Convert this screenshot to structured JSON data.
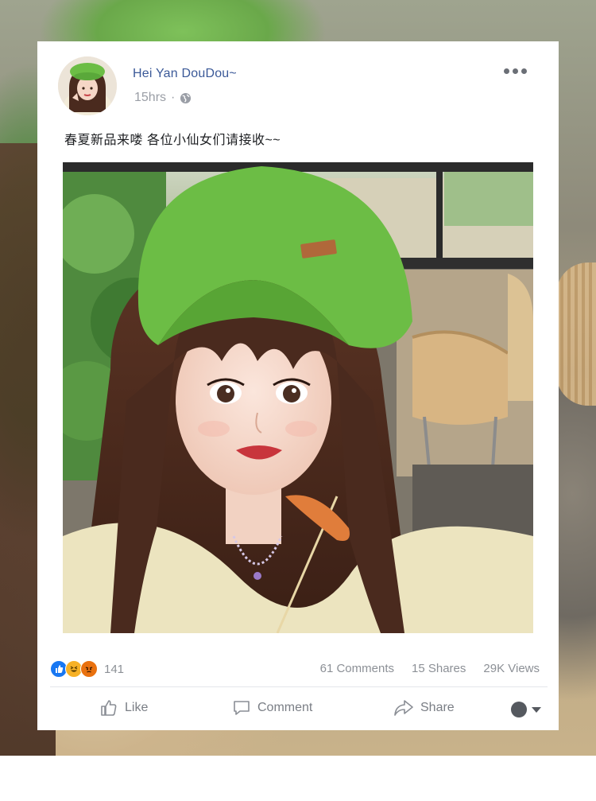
{
  "post": {
    "author_name": "Hei Yan DouDou~",
    "timestamp": "15hrs",
    "separator": "·",
    "privacy_icon": "globe-icon",
    "more_icon": "more-options-icon",
    "caption": "春夏新品来喽 各位小仙女们请接收~~"
  },
  "engagement": {
    "reaction_icons": [
      "like-reaction-icon",
      "haha-reaction-icon",
      "angry-reaction-icon"
    ],
    "reaction_colors": {
      "like": "#1877f2",
      "haha": "#f7b125",
      "angry": "#e9710f"
    },
    "reaction_count": "141",
    "comments": "61 Comments",
    "shares": "15 Shares",
    "views": "29K Views"
  },
  "actions": {
    "like_label": "Like",
    "comment_label": "Comment",
    "share_label": "Share"
  },
  "colors": {
    "author_blue": "#3b5998",
    "muted_text": "#8c9096",
    "beret_green": "#6cbd45"
  }
}
